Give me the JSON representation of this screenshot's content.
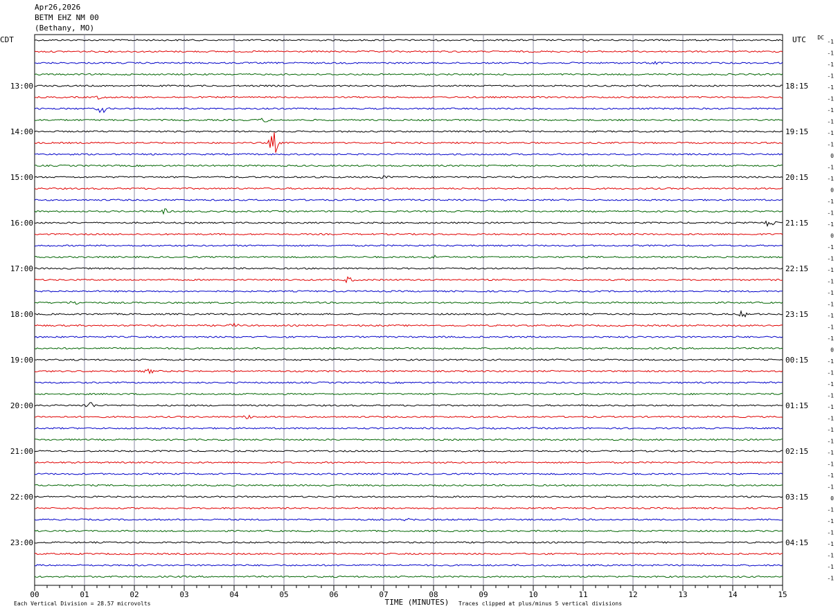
{
  "header": {
    "date": "Apr26,2026",
    "station": "BETM EHZ NM 00",
    "location": "(Bethany, MO)"
  },
  "footer": {
    "vertical_division": "Each Vertical Division =   28.57 microvolts",
    "clip_note": "Traces clipped at plus/minus 5 vertical divisions"
  },
  "chart_data": {
    "type": "line",
    "title": "",
    "xlabel": "TIME (MINUTES)",
    "ylabel_left": "CDT",
    "ylabel_right": "UTC",
    "dc_label": "DC",
    "xlim": [
      0,
      15
    ],
    "x_ticks": [
      "00",
      "01",
      "02",
      "03",
      "04",
      "05",
      "06",
      "07",
      "08",
      "09",
      "10",
      "11",
      "12",
      "13",
      "14",
      "15"
    ],
    "left_hour_labels": [
      "13:00",
      "14:00",
      "15:00",
      "16:00",
      "17:00",
      "18:00",
      "19:00",
      "20:00",
      "21:00",
      "22:00",
      "23:00"
    ],
    "right_hour_labels": [
      "18:15",
      "19:15",
      "20:15",
      "21:15",
      "22:15",
      "23:15",
      "00:15",
      "01:15",
      "02:15",
      "03:15",
      "04:15"
    ],
    "trace_colors": [
      "#000000",
      "#e00000",
      "#0000c8",
      "#006400"
    ],
    "dc_offsets": [
      -1,
      -1,
      -1,
      -1,
      -1,
      -1,
      -1,
      -1,
      -1,
      -1,
      0,
      -1,
      -1,
      0,
      -1,
      -1,
      -1,
      0,
      -1,
      -1,
      -1,
      -1,
      -1,
      -1,
      -1,
      -1,
      -1,
      0,
      -1,
      -1,
      -1,
      -1,
      -1,
      -1,
      -1,
      -1,
      -1,
      -1,
      -1,
      -1,
      0,
      -1,
      -1,
      -1,
      -1,
      -1,
      -1,
      -1
    ],
    "events": [
      {
        "trace": 2,
        "minute": 12.5,
        "amp": 3
      },
      {
        "trace": 4,
        "minute": 12.2,
        "amp": 3
      },
      {
        "trace": 5,
        "minute": 1.3,
        "amp": 2
      },
      {
        "trace": 6,
        "minute": 1.35,
        "amp": 6
      },
      {
        "trace": 7,
        "minute": 4.6,
        "amp": 3
      },
      {
        "trace": 9,
        "minute": 4.8,
        "amp": 16
      },
      {
        "trace": 12,
        "minute": 7.0,
        "amp": 3
      },
      {
        "trace": 15,
        "minute": 2.6,
        "amp": 3
      },
      {
        "trace": 16,
        "minute": 14.75,
        "amp": 8
      },
      {
        "trace": 19,
        "minute": 8.0,
        "amp": 3
      },
      {
        "trace": 21,
        "minute": 6.3,
        "amp": 4
      },
      {
        "trace": 23,
        "minute": 0.8,
        "amp": 3
      },
      {
        "trace": 24,
        "minute": 14.2,
        "amp": 4
      },
      {
        "trace": 25,
        "minute": 4.0,
        "amp": 3
      },
      {
        "trace": 29,
        "minute": 2.3,
        "amp": 3
      },
      {
        "trace": 32,
        "minute": 1.1,
        "amp": 6
      },
      {
        "trace": 33,
        "minute": 4.3,
        "amp": 3
      },
      {
        "trace": 42,
        "minute": 7.5,
        "amp": 2
      }
    ]
  }
}
